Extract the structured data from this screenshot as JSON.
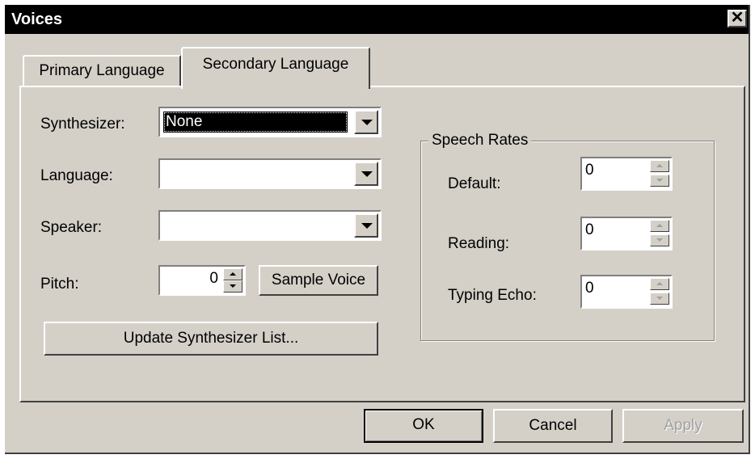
{
  "window": {
    "title": "Voices",
    "close_icon": "close-icon"
  },
  "tabs": [
    {
      "label": "Primary Language",
      "active": false
    },
    {
      "label": "Secondary Language",
      "active": true
    }
  ],
  "form": {
    "synthesizer": {
      "label": "Synthesizer:",
      "value": "None"
    },
    "language": {
      "label": "Language:",
      "value": ""
    },
    "speaker": {
      "label": "Speaker:",
      "value": ""
    },
    "pitch": {
      "label": "Pitch:",
      "value": "0"
    },
    "sample_voice_label": "Sample Voice",
    "update_button_label": "Update Synthesizer List..."
  },
  "speech_rates": {
    "title": "Speech Rates",
    "default": {
      "label": "Default:",
      "value": "0"
    },
    "reading": {
      "label": "Reading:",
      "value": "0"
    },
    "typing_echo": {
      "label": "Typing Echo:",
      "value": "0"
    }
  },
  "buttons": {
    "ok": "OK",
    "cancel": "Cancel",
    "apply": "Apply"
  }
}
